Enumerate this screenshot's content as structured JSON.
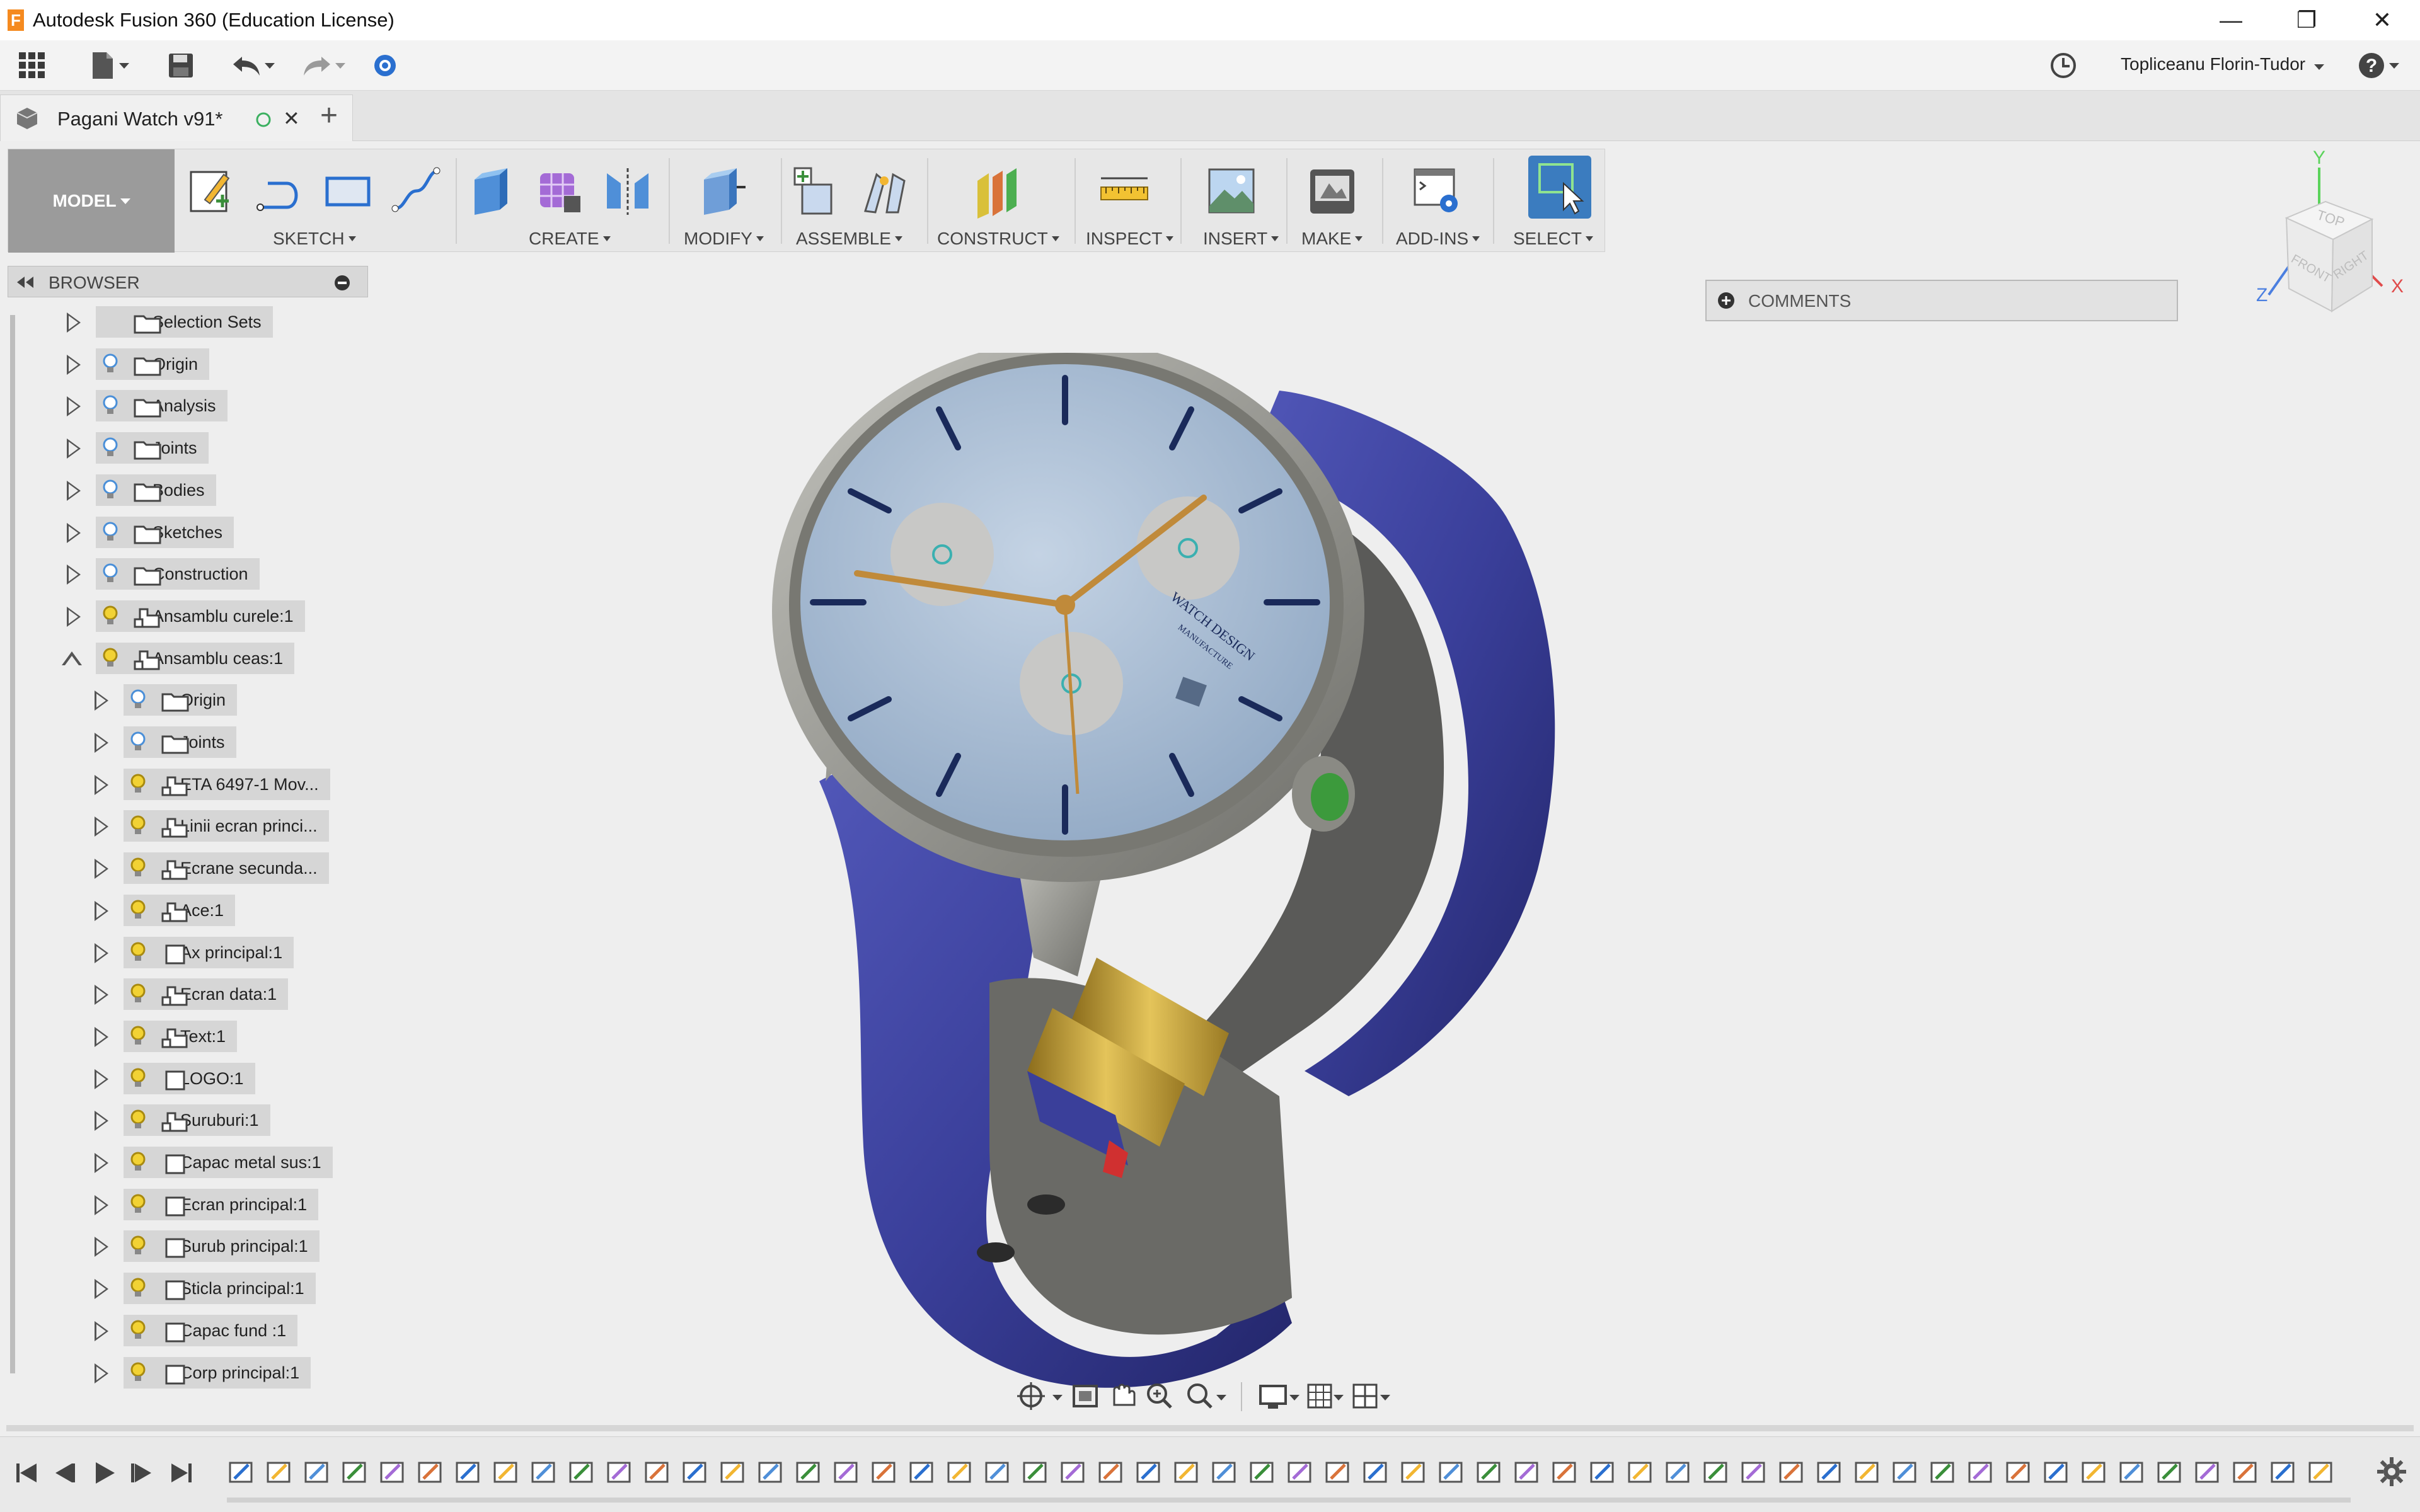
{
  "window": {
    "title": "Autodesk Fusion 360 (Education License)",
    "controls": {
      "minimize": "—",
      "maximize": "❐",
      "close": "✕"
    }
  },
  "quick_access": {
    "user_name": "Topliceanu Florin-Tudor",
    "icons": [
      "apps-grid-icon",
      "file-icon",
      "save-icon",
      "undo-icon",
      "redo-icon",
      "data-panel-icon",
      "job-status-icon",
      "help-icon"
    ]
  },
  "document_tab": {
    "title": "Pagani Watch v91*",
    "new_tab": "+",
    "close": "✕"
  },
  "ribbon": {
    "workspace": "MODEL",
    "groups": [
      {
        "id": "sketch",
        "label": "SKETCH"
      },
      {
        "id": "create",
        "label": "CREATE"
      },
      {
        "id": "modify",
        "label": "MODIFY"
      },
      {
        "id": "assemble",
        "label": "ASSEMBLE"
      },
      {
        "id": "construct",
        "label": "CONSTRUCT"
      },
      {
        "id": "inspect",
        "label": "INSPECT"
      },
      {
        "id": "insert",
        "label": "INSERT"
      },
      {
        "id": "make",
        "label": "MAKE"
      },
      {
        "id": "addins",
        "label": "ADD-INS"
      },
      {
        "id": "select",
        "label": "SELECT"
      }
    ]
  },
  "browser": {
    "title": "BROWSER",
    "items": [
      {
        "label": "Selection Sets",
        "level": 0,
        "bulb": "none",
        "icon": "folder",
        "expanded": false
      },
      {
        "label": "Origin",
        "level": 0,
        "bulb": "off",
        "icon": "folder",
        "expanded": false
      },
      {
        "label": "Analysis",
        "level": 0,
        "bulb": "off",
        "icon": "folder",
        "expanded": false
      },
      {
        "label": "Joints",
        "level": 0,
        "bulb": "off",
        "icon": "folder",
        "expanded": false
      },
      {
        "label": "Bodies",
        "level": 0,
        "bulb": "off",
        "icon": "folder",
        "expanded": false
      },
      {
        "label": "Sketches",
        "level": 0,
        "bulb": "off",
        "icon": "folder",
        "expanded": false
      },
      {
        "label": "Construction",
        "level": 0,
        "bulb": "off",
        "icon": "folder",
        "expanded": false
      },
      {
        "label": "Ansamblu curele:1",
        "level": 0,
        "bulb": "on",
        "icon": "component",
        "expanded": false
      },
      {
        "label": "Ansamblu ceas:1",
        "level": 0,
        "bulb": "on",
        "icon": "component",
        "expanded": true
      },
      {
        "label": "Origin",
        "level": 1,
        "bulb": "off",
        "icon": "folder",
        "expanded": false
      },
      {
        "label": "Joints",
        "level": 1,
        "bulb": "off",
        "icon": "folder",
        "expanded": false
      },
      {
        "label": "ETA 6497-1 Mov...",
        "level": 1,
        "bulb": "on",
        "icon": "component",
        "expanded": false
      },
      {
        "label": "Linii ecran princi...",
        "level": 1,
        "bulb": "on",
        "icon": "component",
        "expanded": false
      },
      {
        "label": "Ecrane secunda...",
        "level": 1,
        "bulb": "on",
        "icon": "component",
        "expanded": false
      },
      {
        "label": "Ace:1",
        "level": 1,
        "bulb": "on",
        "icon": "component",
        "expanded": false
      },
      {
        "label": "Ax principal:1",
        "level": 1,
        "bulb": "on",
        "icon": "body",
        "expanded": false
      },
      {
        "label": "Ecran data:1",
        "level": 1,
        "bulb": "on",
        "icon": "component",
        "expanded": false
      },
      {
        "label": "Text:1",
        "level": 1,
        "bulb": "on",
        "icon": "component",
        "expanded": false
      },
      {
        "label": "LOGO:1",
        "level": 1,
        "bulb": "on",
        "icon": "body",
        "expanded": false
      },
      {
        "label": "Suruburi:1",
        "level": 1,
        "bulb": "on",
        "icon": "component",
        "expanded": false
      },
      {
        "label": "Capac metal sus:1",
        "level": 1,
        "bulb": "on",
        "icon": "body",
        "expanded": false
      },
      {
        "label": "Ecran principal:1",
        "level": 1,
        "bulb": "on",
        "icon": "body",
        "expanded": false
      },
      {
        "label": "Surub principal:1",
        "level": 1,
        "bulb": "on",
        "icon": "body",
        "expanded": false
      },
      {
        "label": "Sticla principal:1",
        "level": 1,
        "bulb": "on",
        "icon": "body",
        "expanded": false
      },
      {
        "label": "Capac fund :1",
        "level": 1,
        "bulb": "on",
        "icon": "body",
        "expanded": false
      },
      {
        "label": "Corp principal:1",
        "level": 1,
        "bulb": "on",
        "icon": "body",
        "expanded": false
      }
    ]
  },
  "comments": {
    "label": "COMMENTS"
  },
  "viewcube": {
    "top": "TOP",
    "front": "FRONT",
    "right": "RIGHT",
    "axis_x": "X",
    "axis_y": "Y",
    "axis_z": "Z"
  },
  "model": {
    "dial_text_1": "WATCH DESIGN",
    "dial_text_2": "MANUFACTURE",
    "strap_color": "#3a3f9a",
    "case_color": "#9a9a94",
    "dial_color": "#a9bdd4",
    "buckle_color": "#c9a43a"
  },
  "navbar": {
    "icons": [
      "orbit-icon",
      "look-at-icon",
      "pan-icon",
      "zoom-icon",
      "fit-icon",
      "display-settings-icon",
      "grid-settings-icon",
      "viewports-icon"
    ]
  },
  "timeline": {
    "controls": [
      "first-icon",
      "previous-icon",
      "play-icon",
      "next-icon",
      "last-icon"
    ],
    "feature_count": 56,
    "settings": "gear-icon"
  }
}
